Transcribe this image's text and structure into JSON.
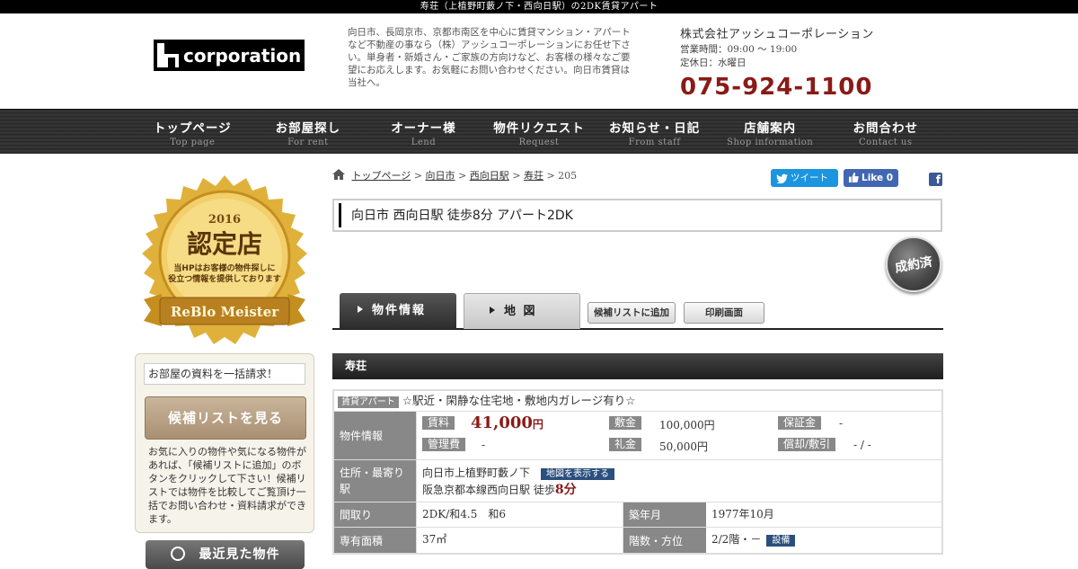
{
  "topbar": {
    "text": "寿荘（上植野町藪ノ下・西向日駅）の2DK賃貸アパート"
  },
  "header": {
    "logo_text": "corporation",
    "intro": "向日市、長岡京市、京都市南区を中心に賃貸マンション・アパートなど不動産の事なら（株）アッシュコーポレーションにお任せ下さい。単身者・新婚さん・ご家族の方向けなど、お客様の様々なご要望にお応えします。お気軽にお問い合わせください。向日市賃貸は当社へ。",
    "company_name": "株式会社アッシュコーポレーション",
    "hours": "営業時間：09:00 ～ 19:00",
    "closed": "定休日：水曜日",
    "tel": "075-924-1100"
  },
  "nav": [
    {
      "jp": "トップページ",
      "en": "Top page"
    },
    {
      "jp": "お部屋探し",
      "en": "For rent"
    },
    {
      "jp": "オーナー様",
      "en": "Lend"
    },
    {
      "jp": "物件リクエスト",
      "en": "Request"
    },
    {
      "jp": "お知らせ・日記",
      "en": "From staff"
    },
    {
      "jp": "店舗案内",
      "en": "Shop information"
    },
    {
      "jp": "お問合わせ",
      "en": "Contact us"
    }
  ],
  "badge": {
    "year": "2016",
    "title": "認定店",
    "line1": "当HPはお客様の物件探しに",
    "line2": "役立つ情報を提供しております",
    "ribbon": "ReBlo Meister"
  },
  "sidebar": {
    "request_label": "お部屋の資料を一括請求！",
    "view_list_button": "候補リストを見る",
    "note": "お気に入りの物件や気になる物件があれば、「候補リストに追加」のボタンをクリックして下さい！候補リストでは物件を比較してご覧頂け一括でお問い合わせ・資料請求ができます。",
    "recent_button": "最近見た物件"
  },
  "breadcrumb": {
    "items": [
      "トップページ",
      "向日市",
      "西向日駅",
      "寿荘"
    ],
    "current": "205",
    "sep": ">"
  },
  "social": {
    "tweet": "ツイート",
    "like": "Like 0",
    "fb_icon": "f"
  },
  "page_title": "向日市 西向日駅 徒歩8分 アパート2DK",
  "stamp": "成約済",
  "tabs": {
    "info": "物件情報",
    "map": "地 図",
    "add_candidate": "候補リストに追加",
    "print": "印刷画面"
  },
  "property": {
    "name": "寿荘",
    "type_tag": "賃貸アパート",
    "catch": "☆駅近・閑静な住宅地・敷地内ガレージ有り☆",
    "labels": {
      "info": "物件情報",
      "address": "住所・最寄り駅",
      "layout": "間取り",
      "built": "築年月",
      "area": "専有面積",
      "floor": "階数・方位"
    },
    "rent_label": "賃料",
    "rent_value": "41,000",
    "rent_unit": "円",
    "deposit_label": "敷金",
    "deposit_value": "100,000円",
    "guarantee_label": "保証金",
    "guarantee_value": "-",
    "mgmt_label": "管理費",
    "mgmt_value": "-",
    "key_label": "礼金",
    "key_value": "50,000円",
    "amort_label": "償却/敷引",
    "amort_value": "- / -",
    "address": "向日市上植野町藪ノ下",
    "map_button": "地図を表示する",
    "station": "阪急京都本線西向日駅 徒歩",
    "walk_min": "8分",
    "layout_value": "2DK/和4.5　和6",
    "built_value": "1977年10月",
    "area_value": "37㎡",
    "floor_value": "2/2階・－",
    "equip_button": "設備"
  }
}
